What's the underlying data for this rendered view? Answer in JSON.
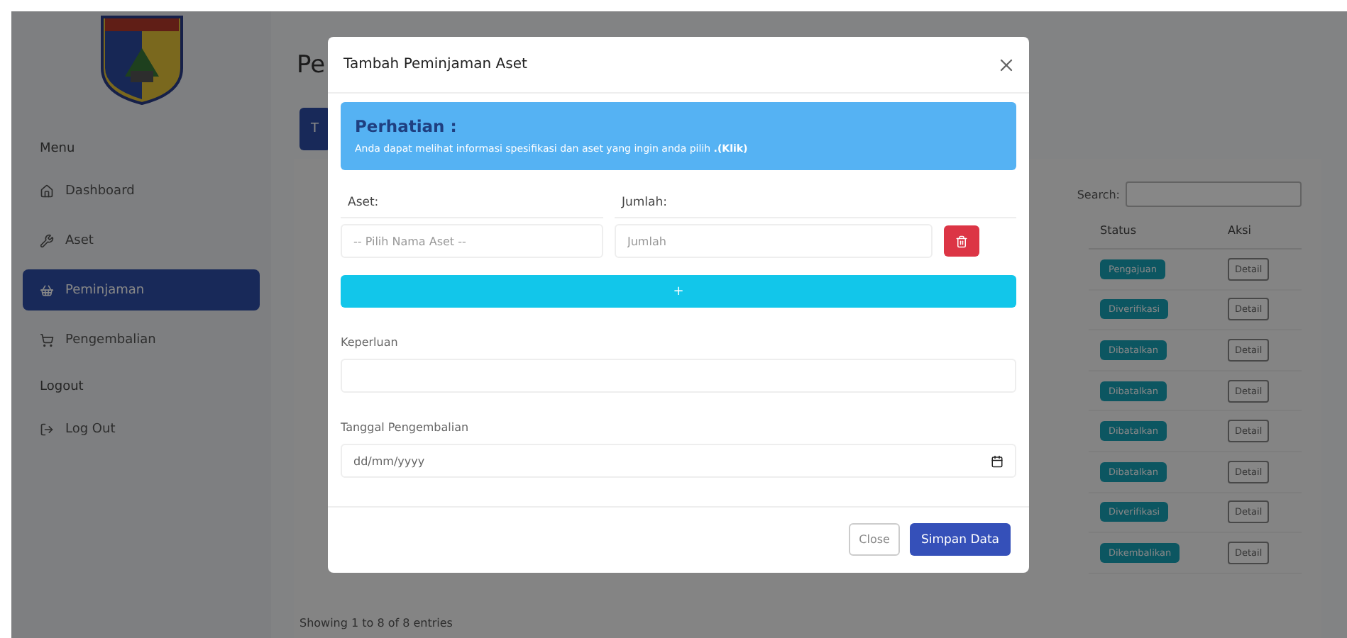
{
  "sidebar": {
    "menu_heading": "Menu",
    "items": [
      {
        "label": "Dashboard",
        "selected": false
      },
      {
        "label": "Aset",
        "selected": false
      },
      {
        "label": "Peminjaman",
        "selected": true
      },
      {
        "label": "Pengembalian",
        "selected": false
      }
    ],
    "logout_heading": "Logout",
    "logout_items": [
      {
        "label": "Log Out",
        "selected": false
      }
    ]
  },
  "page": {
    "title": "Pe",
    "add_button": "T",
    "search_label": "Search:",
    "columns": [
      "Status",
      "Aksi"
    ],
    "rows": [
      {
        "status": "Pengajuan",
        "action": "Detail"
      },
      {
        "status": "Diverifikasi",
        "action": "Detail"
      },
      {
        "status": "Dibatalkan",
        "action": "Detail"
      },
      {
        "status": "Dibatalkan",
        "action": "Detail"
      },
      {
        "status": "Dibatalkan",
        "action": "Detail"
      },
      {
        "status": "Dibatalkan",
        "action": "Detail"
      },
      {
        "status": "Diverifikasi",
        "action": "Detail"
      },
      {
        "status": "Dikembalikan",
        "action": "Detail"
      }
    ],
    "footer": "Showing 1 to 8 of 8 entries"
  },
  "modal": {
    "title": "Tambah Peminjaman Aset",
    "alert": {
      "heading": "Perhatian :",
      "text": "Anda dapat melihat informasi spesifikasi dan aset yang ingin anda pilih **.(Klik)**"
    },
    "asset_label": "Aset:",
    "amount_label": "Jumlah:",
    "asset_placeholder": "-- Pilih Nama Aset --",
    "amount_placeholder": "Jumlah",
    "add_row_button": "+",
    "purpose_label": "Keperluan",
    "return_date_label": "Tanggal Pengembalian",
    "return_date_placeholder": "dd/mm/yyyy",
    "close_button": "Close",
    "save_button": "Simpan Data"
  }
}
